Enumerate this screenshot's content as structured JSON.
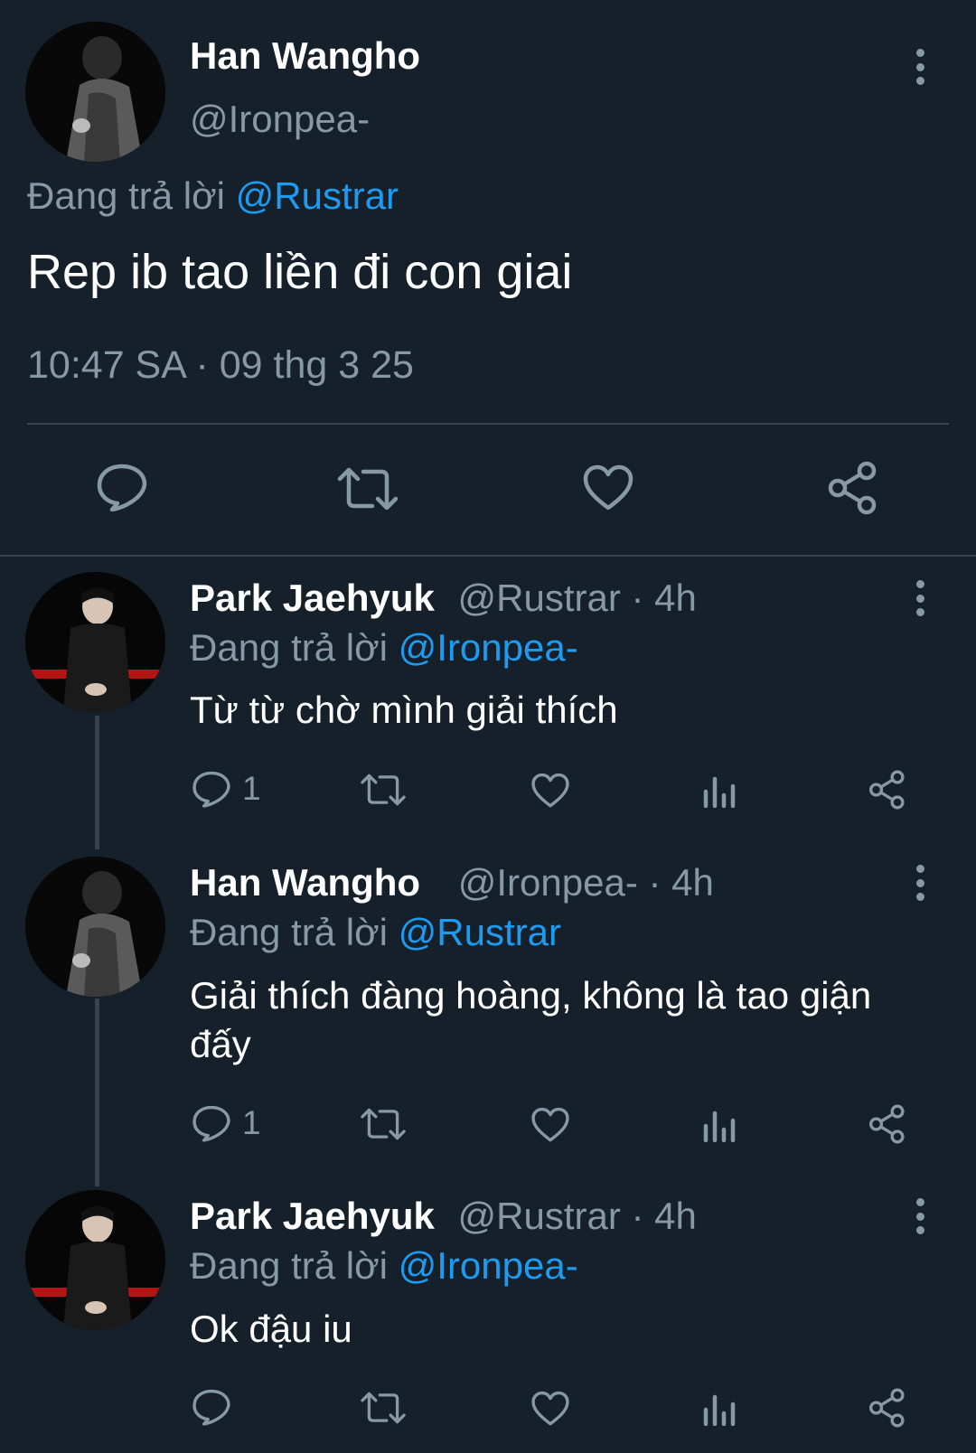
{
  "main_tweet": {
    "author_name": "Han Wangho",
    "author_handle": "@Ironpea-",
    "reply_prefix": "Đang trả lời",
    "reply_to": "@Rustrar",
    "text": "Rep ib tao liền đi con giai",
    "timestamp": "10:47 SA · 09 thg 3 25",
    "actions": [
      "reply-icon",
      "retweet-icon",
      "like-icon",
      "share-icon"
    ]
  },
  "replies": [
    {
      "author_name": "Park Jaehyuk",
      "author_handle": "@Rustrar",
      "time": "· 4h",
      "reply_prefix": "Đang trả lời",
      "reply_to": "@Ironpea-",
      "text": "Từ từ chờ mình giải thích",
      "reply_count": "1"
    },
    {
      "author_name": "Han Wangho",
      "author_handle": "@Ironpea-",
      "time": "· 4h",
      "reply_prefix": "Đang trả lời",
      "reply_to": "@Rustrar",
      "text_line1": "Giải thích đàng hoàng, không là tao giận",
      "text_line2": "đấy",
      "reply_count": "1"
    },
    {
      "author_name": "Park Jaehyuk",
      "author_handle": "@Rustrar",
      "time": "· 4h",
      "reply_prefix": "Đang trả lời",
      "reply_to": "@Ironpea-",
      "text": "Ok đậu iu",
      "reply_count": ""
    }
  ],
  "colors": {
    "background": "#15202b",
    "muted": "#8899a6",
    "link": "#1d9bf0",
    "divider": "#38444d"
  }
}
